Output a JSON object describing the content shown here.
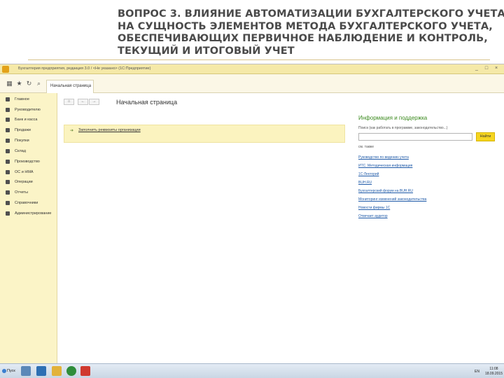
{
  "slide": {
    "title_lines": [
      "ВОПРОС 3. ВЛИЯНИЕ АВТОМАТИЗАЦИИ БУХГАЛТЕРСКОГО УЧЕТА",
      "НА СУЩНОСТЬ ЭЛЕМЕНТОВ МЕТОДА БУХГАЛТЕРСКОГО УЧЕТА,",
      "ОБЕСПЕЧИВАЮЩИХ ПЕРВИЧНОЕ НАБЛЮДЕНИЕ И КОНТРОЛЬ,",
      "ТЕКУЩИЙ И ИТОГОВЫЙ УЧЕТ"
    ]
  },
  "window": {
    "title": "Бухгалтерия предприятия, редакция 3.0 / <Не указано> (1С:Предприятие)",
    "controls": [
      "_",
      "□",
      "×"
    ]
  },
  "toolbar": {
    "icons": [
      "grid-icon",
      "star-icon",
      "history-icon",
      "search-icon"
    ],
    "home_tab": "Начальная страница"
  },
  "sidebar": {
    "items": [
      {
        "label": "Главное",
        "icon": "home-icon"
      },
      {
        "label": "Руководителю",
        "icon": "chart-icon"
      },
      {
        "label": "Банк и касса",
        "icon": "bank-icon"
      },
      {
        "label": "Продажи",
        "icon": "cart-icon"
      },
      {
        "label": "Покупки",
        "icon": "purchase-icon"
      },
      {
        "label": "Склад",
        "icon": "warehouse-icon"
      },
      {
        "label": "Производство",
        "icon": "production-icon"
      },
      {
        "label": "ОС и НМА",
        "icon": "assets-icon"
      },
      {
        "label": "Операции",
        "icon": "operations-icon"
      },
      {
        "label": "Отчеты",
        "icon": "reports-icon"
      },
      {
        "label": "Справочники",
        "icon": "directory-icon"
      },
      {
        "label": "Администрирование",
        "icon": "admin-icon"
      }
    ]
  },
  "main": {
    "nav": [
      "⌂",
      "←",
      "→"
    ],
    "heading": "Начальная страница",
    "notice_link": "Заполнить реквизиты организации"
  },
  "info": {
    "title": "Информация и поддержка",
    "search_hint": "Поиск (как работать в программе, законодательство...)",
    "search_value": "",
    "search_button": "Найти",
    "see_also": "см. также",
    "links": [
      "Руководство по ведению учета",
      "ИТС. Методическая информация",
      "1С:Лекторий",
      "BUH.RU",
      "Бухгалтерский форум на BUH.RU",
      "Мониторинг изменений законодательства",
      "Новости фирмы 1С",
      "Отвечает аудитор"
    ]
  },
  "taskbar": {
    "start": "Пуск",
    "language": "EN",
    "time": "11:08",
    "date": "18.09.2015",
    "colors": {
      "app1": "#5b88b8",
      "app2": "#2d6fb3",
      "app3": "#e2b23a",
      "app4": "#2f8d3b",
      "app5": "#d0392f"
    }
  }
}
